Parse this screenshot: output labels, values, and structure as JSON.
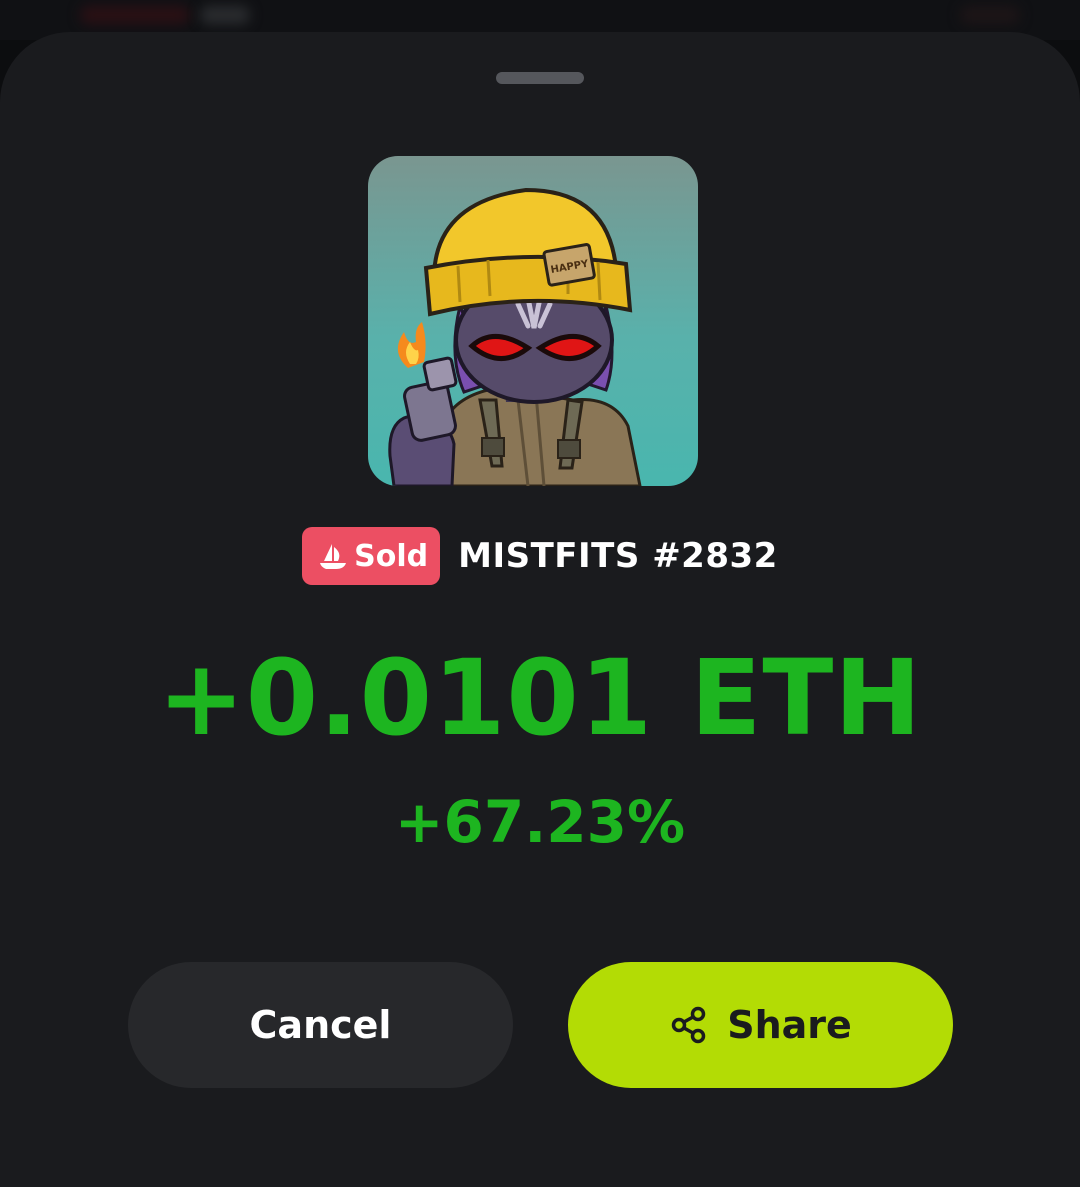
{
  "sheet": {
    "nft": {
      "image_alt": "MISTFITS #2832 artwork",
      "name": "MISTFITS #2832",
      "status_badge": "Sold",
      "status_icon": "opensea-ship-icon",
      "hat_patch_text": "HAPPY"
    },
    "profit": {
      "eth": "+0.0101 ETH",
      "percent": "+67.23%"
    },
    "actions": {
      "cancel_label": "Cancel",
      "share_label": "Share",
      "share_icon": "share-icon"
    }
  },
  "colors": {
    "sheet_bg": "#1a1b1e",
    "profit_green": "#1db520",
    "sold_badge": "#ec4f63",
    "share_button": "#b3dc05",
    "cancel_button": "#27282b"
  }
}
